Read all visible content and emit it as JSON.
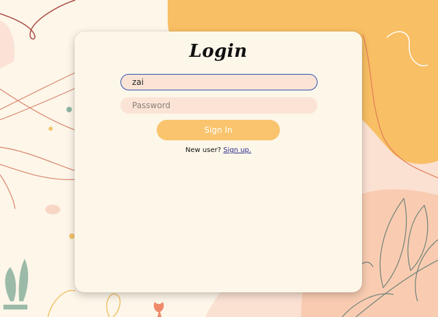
{
  "login": {
    "title": "Login",
    "username_value": "zai",
    "password_placeholder": "Password",
    "signin_label": "Sign In",
    "newuser_text": "New user?",
    "signup_link": "Sign up."
  },
  "colors": {
    "background": "#fdf6e9",
    "card": "#fdf7ea",
    "input_fill": "#fbe4d6",
    "focus_border": "#2f4db0",
    "button": "#f9c46d",
    "accent_orange": "#f8bf64",
    "accent_peach": "#f8d1b8",
    "leaf_green": "#9bbba8"
  }
}
